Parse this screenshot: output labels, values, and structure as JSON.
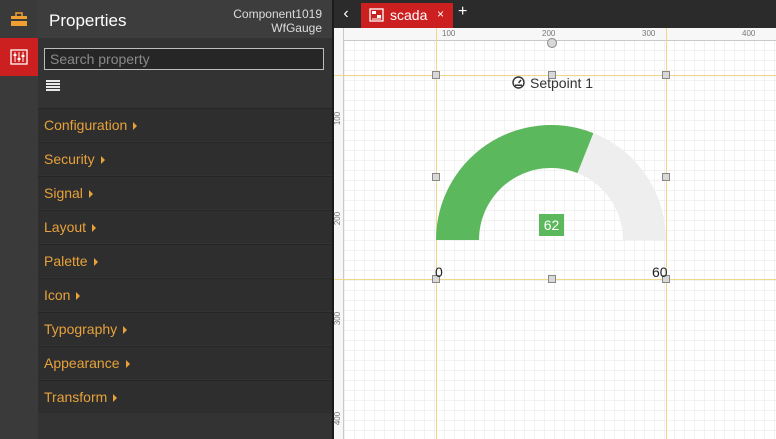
{
  "properties_panel": {
    "title": "Properties",
    "component_name": "Component1019",
    "component_type": "WfGauge",
    "search_placeholder": "Search property",
    "sections": [
      {
        "label": "Configuration"
      },
      {
        "label": "Security"
      },
      {
        "label": "Signal"
      },
      {
        "label": "Layout"
      },
      {
        "label": "Palette"
      },
      {
        "label": "Icon"
      },
      {
        "label": "Typography"
      },
      {
        "label": "Appearance"
      },
      {
        "label": "Transform"
      }
    ]
  },
  "tabs": {
    "active_tab": "scada",
    "close_glyph": "×",
    "add_glyph": "+",
    "back_glyph": "‹"
  },
  "canvas": {
    "ruler_top_labels": [
      "100",
      "200",
      "300",
      "400"
    ],
    "ruler_left_labels": [
      "100",
      "200",
      "300",
      "400"
    ]
  },
  "gauge": {
    "label": "Setpoint 1",
    "value": 62,
    "value_text": "62",
    "min": 0,
    "max": 60,
    "min_text": "0",
    "max_text": "60",
    "fill_color": "#5cb85c",
    "track_color": "#eeeeee"
  },
  "colors": {
    "accent": "#cc1f1f",
    "section_text": "#e8a23a"
  }
}
